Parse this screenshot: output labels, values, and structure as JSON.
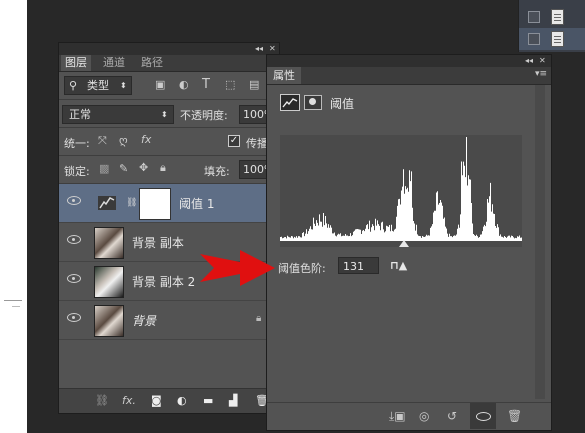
{
  "files_panel": {
    "rows": 2
  },
  "layers_panel": {
    "tabs": [
      "图层",
      "通道",
      "路径"
    ],
    "active_tab": 0,
    "filter_kind": "类型",
    "blend_mode": "正常",
    "opacity_label": "不透明度:",
    "opacity_value": "100%",
    "unify_label": "统一:",
    "propagate_label": "传播",
    "lock_label": "锁定:",
    "fill_label": "填充:",
    "fill_value": "100%",
    "layers": [
      {
        "name": "阈值 1",
        "type": "adjustment",
        "selected": true
      },
      {
        "name": "背景 副本",
        "type": "photo",
        "selected": false
      },
      {
        "name": "背景 副本 2",
        "type": "photo2",
        "selected": false
      },
      {
        "name": "背景",
        "type": "photo",
        "selected": false,
        "locked": true
      }
    ],
    "bottom_icons": [
      "link-icon",
      "fx-icon",
      "mask-icon",
      "adjustment-icon",
      "folder-icon",
      "new-layer-icon",
      "trash-icon"
    ]
  },
  "properties_panel": {
    "tab": "属性",
    "title": "阈值",
    "threshold_label": "阈值色阶:",
    "threshold_value": "131",
    "threshold_fraction": 0.514,
    "bottom_icons": [
      "clip-icon",
      "view-previous-icon",
      "reset-icon",
      "visibility-icon",
      "trash-icon"
    ]
  },
  "colors": {
    "panel_bg": "#535353",
    "selected_layer": "#5e6e86",
    "annotation_arrow": "#e01010"
  }
}
